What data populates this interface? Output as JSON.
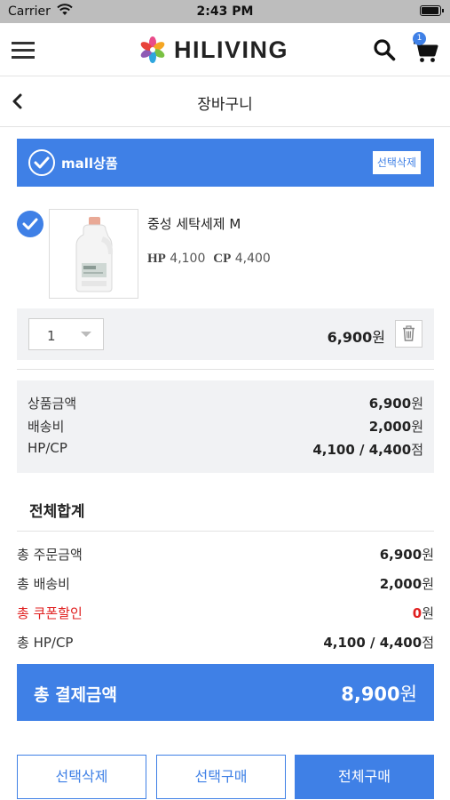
{
  "status_bar": {
    "carrier": "Carrier",
    "time": "2:43 PM",
    "battery_level": 1.0
  },
  "header": {
    "logo_text": "HILIVING",
    "cart_count": "1"
  },
  "page": {
    "title": "장바구니"
  },
  "mall": {
    "label": "mall상품",
    "select_delete_label": "선택삭제"
  },
  "product": {
    "name": "중성 세탁세제 M",
    "hp_label": "HP",
    "hp_value": "4,100",
    "cp_label": "CP",
    "cp_value": "4,400",
    "quantity": "1",
    "price": "6,900",
    "price_unit": "원"
  },
  "summary": {
    "rows": [
      {
        "label": "상품금액",
        "value": "6,900",
        "unit": "원"
      },
      {
        "label": "배송비",
        "value": "2,000",
        "unit": "원"
      },
      {
        "label": "HP/CP",
        "value": "4,100 / 4,400",
        "unit": "점"
      }
    ]
  },
  "totals": {
    "heading": "전체합계",
    "rows": [
      {
        "label": "총 주문금액",
        "value": "6,900",
        "unit": "원"
      },
      {
        "label": "총 배송비",
        "value": "2,000",
        "unit": "원"
      },
      {
        "label": "총 쿠폰할인",
        "value": "0",
        "unit": "원"
      },
      {
        "label": "총 HP/CP",
        "value": "4,100 / 4,400",
        "unit": "점"
      }
    ],
    "grand_label": "총 결제금액",
    "grand_value": "8,900",
    "grand_unit": "원"
  },
  "buttons": {
    "select_delete": "선택삭제",
    "select_buy": "선택구매",
    "buy_all": "전체구매"
  },
  "colors": {
    "accent": "#3f80e6",
    "coupon_red": "#e02020",
    "panel_gray": "#f1f2f4"
  },
  "icons": [
    "wifi-icon",
    "battery-icon",
    "menu-icon",
    "logo-flower-icon",
    "search-icon",
    "cart-icon",
    "back-chevron-icon",
    "check-icon",
    "caret-down-icon",
    "trash-icon"
  ]
}
